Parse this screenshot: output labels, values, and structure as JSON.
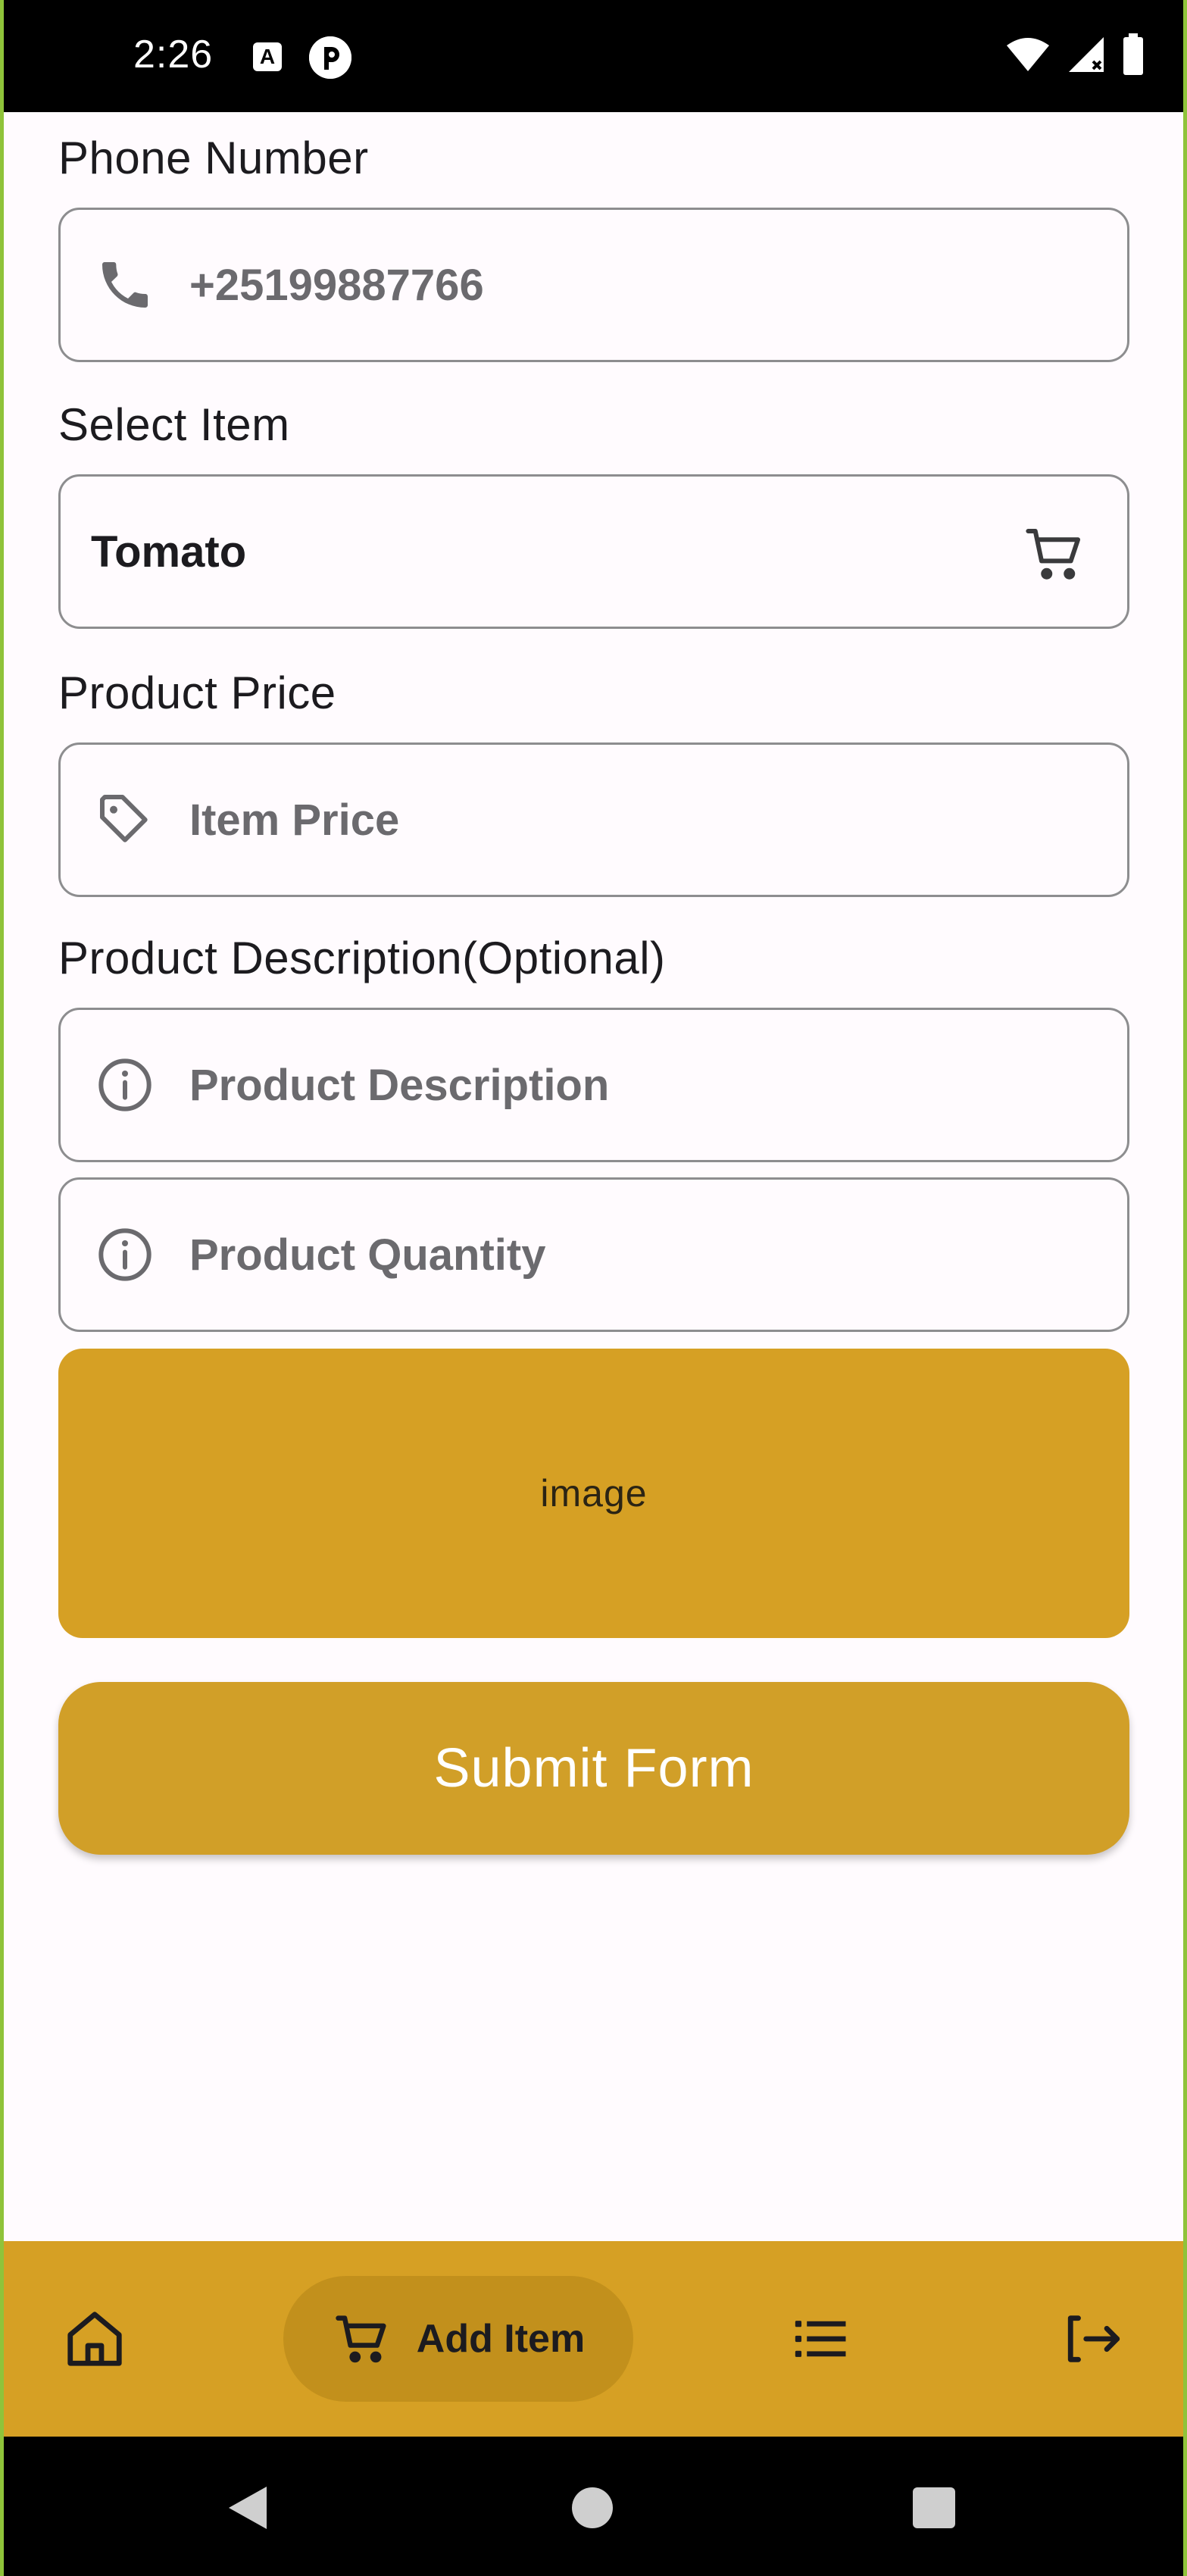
{
  "status_bar": {
    "time": "2:26",
    "notification_icons": [
      "a-box-icon",
      "p-circle-icon"
    ],
    "system_icons": [
      "wifi-icon",
      "signal-icon",
      "battery-icon"
    ]
  },
  "form": {
    "phone": {
      "label": "Phone Number",
      "value": "+25199887766",
      "icon": "phone-icon"
    },
    "item": {
      "label": "Select Item",
      "value": "Tomato",
      "icon": "cart-icon"
    },
    "price": {
      "label": "Product Price",
      "placeholder": "Item Price",
      "icon": "tag-icon"
    },
    "description": {
      "label": "Product Description(Optional)",
      "placeholder": "Product Description",
      "icon": "info-icon"
    },
    "quantity": {
      "placeholder": "Product Quantity",
      "icon": "info-icon"
    },
    "image_placeholder": "image",
    "submit_label": "Submit Form"
  },
  "bottom_nav": {
    "items": [
      {
        "name": "home",
        "icon": "home-icon",
        "label": ""
      },
      {
        "name": "add-item",
        "icon": "cart-icon",
        "label": "Add Item",
        "selected": true
      },
      {
        "name": "list",
        "icon": "list-icon",
        "label": ""
      },
      {
        "name": "logout",
        "icon": "logout-icon",
        "label": ""
      }
    ]
  },
  "colors": {
    "accent": "#d6a024",
    "accent_dark": "#c2901c",
    "submit": "#d19f28",
    "background": "#fffbfe",
    "border": "#8d8d8f"
  }
}
